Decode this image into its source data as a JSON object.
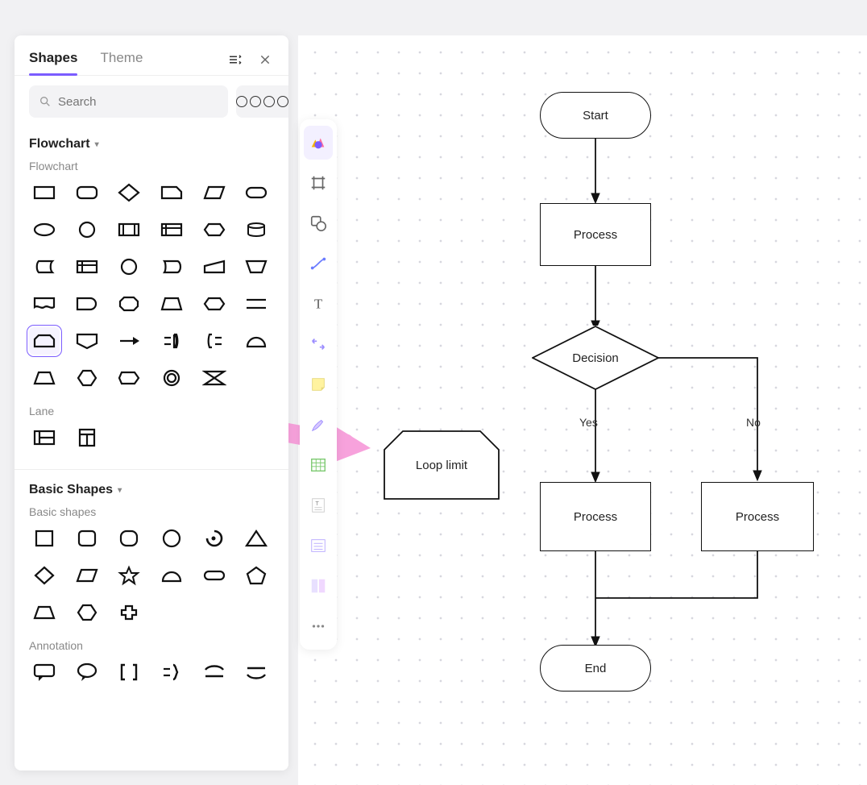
{
  "panel": {
    "tabs": [
      "Shapes",
      "Theme"
    ],
    "activeTab": 0,
    "search": {
      "placeholder": "Search"
    },
    "sections": [
      {
        "title": "Flowchart",
        "groups": [
          {
            "label": "Flowchart"
          },
          {
            "label": "Lane"
          }
        ]
      },
      {
        "title": "Basic Shapes",
        "groups": [
          {
            "label": "Basic shapes"
          },
          {
            "label": "Annotation"
          }
        ]
      }
    ],
    "selectedShape": "loop-limit"
  },
  "toolbar": {
    "items": [
      "shapes-library",
      "frame",
      "shape",
      "connector",
      "text",
      "arrange",
      "sticky-note",
      "pen",
      "table",
      "text-block",
      "list",
      "template",
      "more"
    ]
  },
  "canvas": {
    "nodes": {
      "start": {
        "label": "Start"
      },
      "process1": {
        "label": "Process"
      },
      "decision": {
        "label": "Decision"
      },
      "processYes": {
        "label": "Process"
      },
      "processNo": {
        "label": "Process"
      },
      "end": {
        "label": "End"
      },
      "looplimit": {
        "label": "Loop limit"
      }
    },
    "edgeLabels": {
      "yes": "Yes",
      "no": "No"
    }
  }
}
